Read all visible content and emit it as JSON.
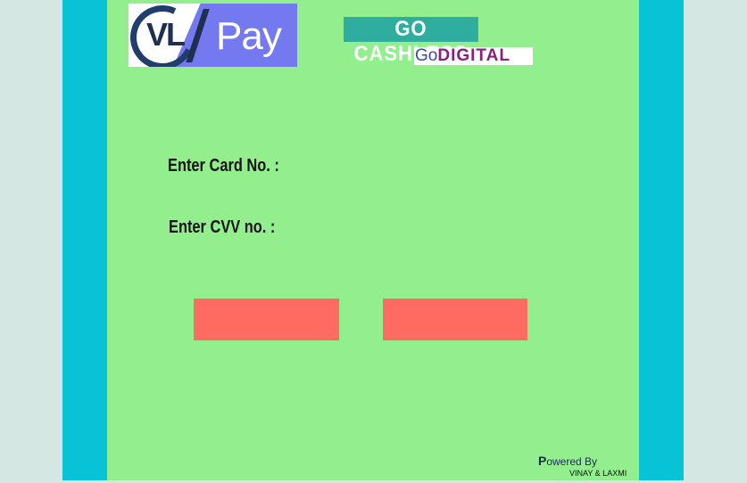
{
  "logo": {
    "brand_left": "VL",
    "brand_right": "Pay"
  },
  "slogan": {
    "line1": "GO CASHLESS",
    "line2_go": "Go",
    "line2_digital": "DIGITAL"
  },
  "form": {
    "card_label": "Enter Card No.  :",
    "cvv_label": "Enter CVV no.  :"
  },
  "buttons": {
    "left_label": "",
    "right_label": ""
  },
  "footer": {
    "powered_first": "P",
    "powered_rest": "owered By",
    "credits": "VINAY & LAXMI"
  },
  "colors": {
    "background": "#d5e7e3",
    "frame": "#08c2d6",
    "panel": "#93ee8e",
    "button": "#ff6a61",
    "cashless_bg": "#2faea0",
    "logo_blue": "#7479f0"
  }
}
